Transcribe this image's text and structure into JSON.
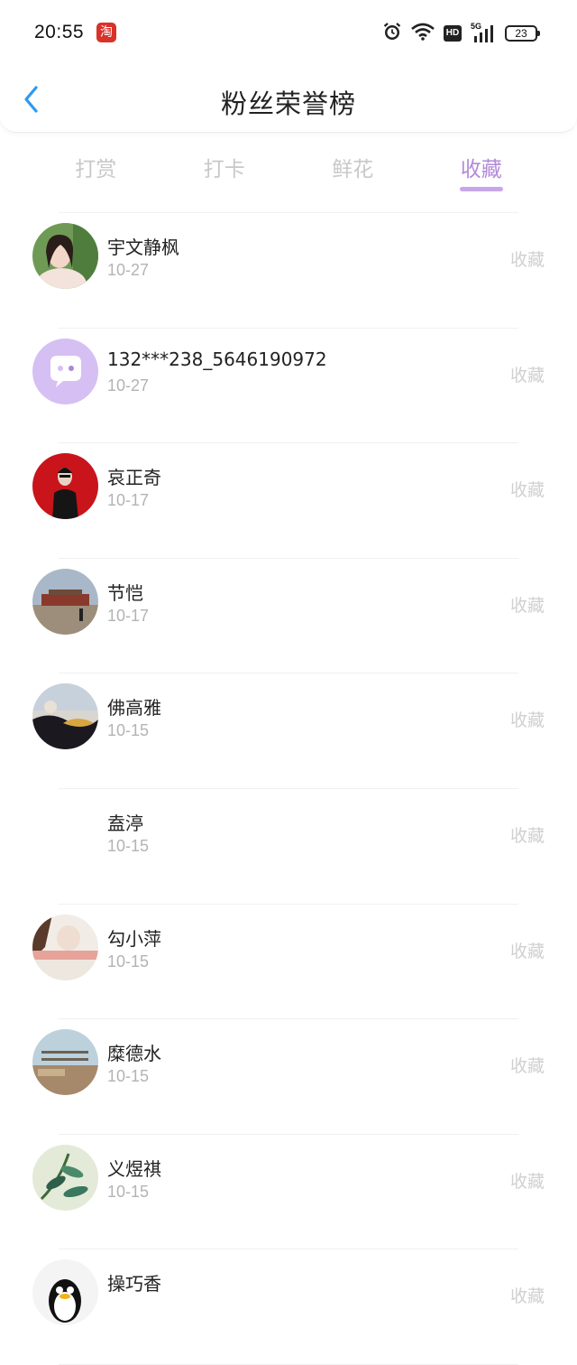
{
  "status_bar": {
    "time": "20:55",
    "taobao_glyph": "淘",
    "icons": [
      "alarm-icon",
      "wifi-icon",
      "hd-icon",
      "5g-signal-icon",
      "battery-icon"
    ],
    "hd_label": "HD",
    "network_label": "5G",
    "battery_level": "23"
  },
  "header": {
    "title": "粉丝荣誉榜",
    "back_icon": "chevron-left-icon",
    "accent_color": "#2b9af3"
  },
  "tabs": [
    {
      "label": "打赏",
      "active": false
    },
    {
      "label": "打卡",
      "active": false
    },
    {
      "label": "鲜花",
      "active": false
    },
    {
      "label": "收藏",
      "active": true
    }
  ],
  "active_tab_color": "#b38ad9",
  "fans": [
    {
      "name": "宇文静枫",
      "date": "10-27",
      "action": "收藏"
    },
    {
      "name": "132***238_5646190972",
      "date": "10-27",
      "action": "收藏"
    },
    {
      "name": "哀正奇",
      "date": "10-17",
      "action": "收藏"
    },
    {
      "name": "节恺",
      "date": "10-17",
      "action": "收藏"
    },
    {
      "name": "佛高雅",
      "date": "10-15",
      "action": "收藏"
    },
    {
      "name": "盍渟",
      "date": "10-15",
      "action": "收藏"
    },
    {
      "name": "勾小萍",
      "date": "10-15",
      "action": "收藏"
    },
    {
      "name": "糜德水",
      "date": "10-15",
      "action": "收藏"
    },
    {
      "name": "义煜祺",
      "date": "10-15",
      "action": "收藏"
    },
    {
      "name": "操巧香",
      "date": "",
      "action": "收藏"
    }
  ]
}
